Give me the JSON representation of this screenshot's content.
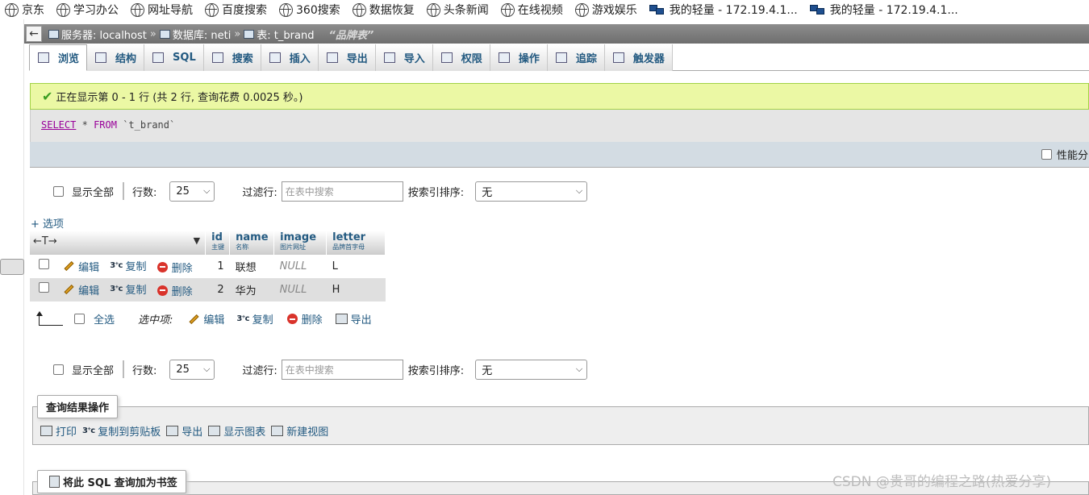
{
  "bookmarks": [
    {
      "label": "京东",
      "icon": "globe-icon"
    },
    {
      "label": "学习办公",
      "icon": "globe-icon"
    },
    {
      "label": "网址导航",
      "icon": "globe-icon"
    },
    {
      "label": "百度搜索",
      "icon": "globe-icon"
    },
    {
      "label": "360搜索",
      "icon": "globe-icon"
    },
    {
      "label": "数据恢复",
      "icon": "globe-icon"
    },
    {
      "label": "头条新闻",
      "icon": "globe-icon"
    },
    {
      "label": "在线视频",
      "icon": "globe-icon"
    },
    {
      "label": "游戏娱乐",
      "icon": "globe-icon"
    },
    {
      "label": "我的轻量 - 172.19.4.1...",
      "icon": "network-icon"
    },
    {
      "label": "我的轻量 - 172.19.4.1...",
      "icon": "network-icon"
    }
  ],
  "breadcrumb": {
    "back": "←",
    "server_label": "服务器: localhost",
    "db_label": "数据库: neti",
    "table_label": "表: t_brand",
    "sep": "»",
    "comment": "“品牌表”"
  },
  "tabs": [
    {
      "label": "浏览",
      "icon": "browse-icon",
      "active": true
    },
    {
      "label": "结构",
      "icon": "structure-icon"
    },
    {
      "label": "SQL",
      "icon": "sql-icon"
    },
    {
      "label": "搜索",
      "icon": "search-icon"
    },
    {
      "label": "插入",
      "icon": "insert-icon"
    },
    {
      "label": "导出",
      "icon": "export-icon"
    },
    {
      "label": "导入",
      "icon": "import-icon"
    },
    {
      "label": "权限",
      "icon": "privileges-icon"
    },
    {
      "label": "操作",
      "icon": "operations-icon"
    },
    {
      "label": "追踪",
      "icon": "tracking-icon"
    },
    {
      "label": "触发器",
      "icon": "triggers-icon"
    }
  ],
  "success": {
    "message": "正在显示第 0 - 1 行 (共 2 行, 查询花费 0.0025 秒。)"
  },
  "sql": {
    "select": "SELECT",
    "star": "*",
    "from": "FROM",
    "table": "`t_brand`"
  },
  "profiling": {
    "label": "性能分"
  },
  "nav": {
    "show_all": "显示全部",
    "rows_label": "行数:",
    "rows_value": "25",
    "filter_label": "过滤行:",
    "filter_placeholder": "在表中搜索",
    "sort_label": "按索引排序:",
    "sort_value": "无"
  },
  "options_link": "+ 选项",
  "table": {
    "arrows": "←T→",
    "columns": [
      {
        "name": "id",
        "comment": "主键"
      },
      {
        "name": "name",
        "comment": "名称"
      },
      {
        "name": "image",
        "comment": "图片网址"
      },
      {
        "name": "letter",
        "comment": "品牌首字母"
      }
    ],
    "actions": {
      "edit": "编辑",
      "copy": "复制",
      "delete": "删除"
    },
    "rows": [
      {
        "id": "1",
        "name": "联想",
        "image": "NULL",
        "letter": "L"
      },
      {
        "id": "2",
        "name": "华为",
        "image": "NULL",
        "letter": "H"
      }
    ]
  },
  "bulk": {
    "check_all": "全选",
    "with_selected": "选中项:",
    "edit": "编辑",
    "copy": "复制",
    "delete": "删除",
    "export": "导出"
  },
  "query_ops": {
    "legend": "查询结果操作",
    "items": [
      {
        "label": "打印",
        "icon": "print-icon"
      },
      {
        "label": "复制到剪贴板",
        "icon": "copy-icon"
      },
      {
        "label": "导出",
        "icon": "export-icon"
      },
      {
        "label": "显示图表",
        "icon": "chart-icon"
      },
      {
        "label": "新建视图",
        "icon": "new-view-icon"
      }
    ]
  },
  "bookmark_sql": {
    "legend": "将此 SQL 查询加为书签"
  },
  "watermark": "CSDN @贵哥的编程之路(热爱分享)"
}
